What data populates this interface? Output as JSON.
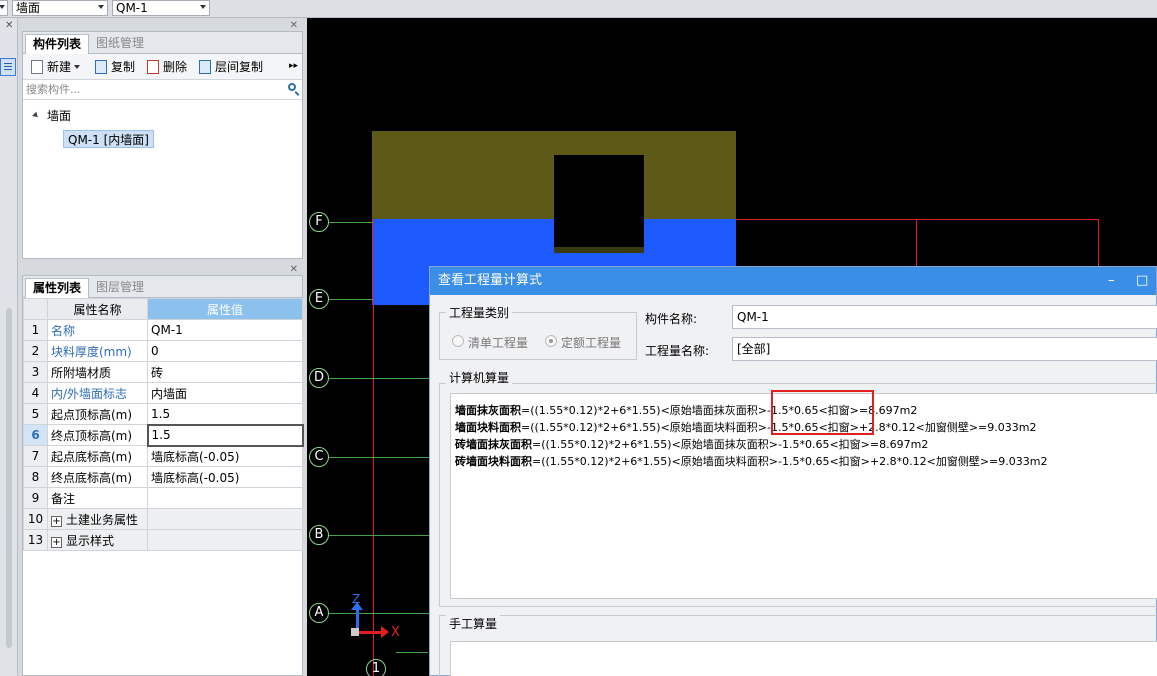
{
  "topbar": {
    "combo1_value": "墙面",
    "combo2_value": "QM-1"
  },
  "component_panel": {
    "tabs": [
      "构件列表",
      "图纸管理"
    ],
    "toolbar": {
      "new_label": "新建",
      "copy_label": "复制",
      "delete_label": "删除",
      "floor_copy_label": "层间复制"
    },
    "search_placeholder": "搜索构件...",
    "tree": {
      "root": "墙面",
      "child": "QM-1 [内墙面]"
    }
  },
  "property_panel": {
    "tabs": [
      "属性列表",
      "图层管理"
    ],
    "headers": [
      "属性名称",
      "属性值"
    ],
    "rows": [
      {
        "num": "1",
        "name": "名称",
        "value": "QM-1"
      },
      {
        "num": "2",
        "name": "块料厚度(mm)",
        "value": "0"
      },
      {
        "num": "3",
        "name": "所附墙材质",
        "value": "砖"
      },
      {
        "num": "4",
        "name": "内/外墙面标志",
        "value": "内墙面"
      },
      {
        "num": "5",
        "name": "起点顶标高(m)",
        "value": "1.5"
      },
      {
        "num": "6",
        "name": "终点顶标高(m)",
        "value": "1.5"
      },
      {
        "num": "7",
        "name": "起点底标高(m)",
        "value": "墙底标高(-0.05)"
      },
      {
        "num": "8",
        "name": "终点底标高(m)",
        "value": "墙底标高(-0.05)"
      },
      {
        "num": "9",
        "name": "备注",
        "value": ""
      },
      {
        "num": "10",
        "name": "土建业务属性",
        "value": ""
      },
      {
        "num": "13",
        "name": "显示样式",
        "value": ""
      }
    ]
  },
  "canvas": {
    "axes": [
      "F",
      "E",
      "D",
      "C",
      "B",
      "A"
    ],
    "bottom_axis": "1",
    "coord_x": "X",
    "coord_z": "Z"
  },
  "dialog": {
    "title": "查看工程量计算式",
    "minimize": "–",
    "maximize": "□",
    "category_legend": "工程量类别",
    "radio_list": "清单工程量",
    "radio_quota": "定额工程量",
    "component_name_label": "构件名称:",
    "component_name_value": "QM-1",
    "quantity_name_label": "工程量名称:",
    "quantity_name_value": "[全部]",
    "computer_legend": "计算机算量",
    "formulas": [
      {
        "name": "墙面抹灰面积",
        "expr": "=((1.55*0.12)*2+6*1.55)<原始墙面抹灰面积>-1.5*0.65<扣窗>=8.697m2"
      },
      {
        "name": "墙面块料面积",
        "expr": "=((1.55*0.12)*2+6*1.55)<原始墙面块料面积>-1.5*0.65<扣窗>+2.8*0.12<加窗侧壁>=9.033m2"
      },
      {
        "name": "砖墙面抹灰面积",
        "expr": "=((1.55*0.12)*2+6*1.55)<原始墙面抹灰面积>-1.5*0.65<扣窗>=8.697m2"
      },
      {
        "name": "砖墙面块料面积",
        "expr": "=((1.55*0.12)*2+6*1.55)<原始墙面块料面积>-1.5*0.65<扣窗>+2.8*0.12<加窗侧壁>=9.033m2"
      }
    ],
    "manual_legend": "手工算量"
  }
}
